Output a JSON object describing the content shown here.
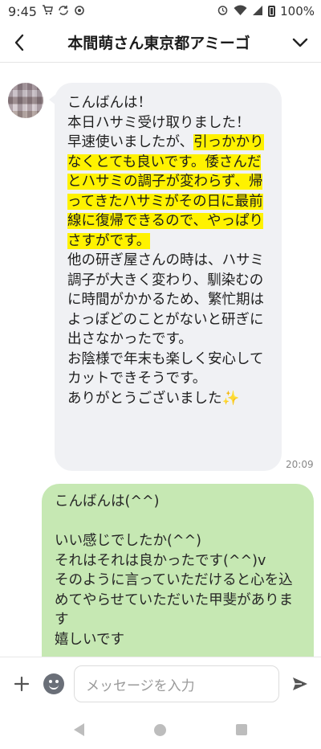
{
  "status_bar": {
    "time": "9:45",
    "battery_percent": "100%",
    "left_icons": [
      "cart-icon",
      "sync-icon",
      "settings-icon"
    ],
    "right_icons": [
      "alarm-icon",
      "wifi-icon",
      "signal-icon",
      "battery-icon"
    ]
  },
  "header": {
    "title": "本間萌さん東京都アミーゴ",
    "back_icon": "back-arrow-icon",
    "menu_icon": "chevron-down-icon"
  },
  "messages": [
    {
      "direction": "incoming",
      "segments": [
        {
          "text": "こんばんは！\n本日ハサミ受け取りました！\n早速使いましたが、",
          "highlight": false
        },
        {
          "text": "引っかかりなくとても良いです。倭さんだとハサミの調子が変わらず、帰ってきたハサミがその日に最前線に復帰できるので、やっぱりさすがです。",
          "highlight": true
        },
        {
          "text": "\n他の研ぎ屋さんの時は、ハサミ調子が大きく変わり、馴染むのに時間がかかるため、繁忙期はよっぽどのことがないと研ぎに出さなかったです。\nお陰様で年末も楽しく安心してカットできそうです。\nありがとうございました✨",
          "highlight": false
        }
      ],
      "time": "20:09"
    },
    {
      "direction": "outgoing",
      "text": "こんばんは(^^)\n\nいい感じでしたか(^^)\nそれはそれは良かったです(^^)v\nそのように言っていただけると心を込めてやらせていただいた甲斐があります\n嬉しいです"
    }
  ],
  "input": {
    "placeholder": "メッセージを入力",
    "plus_icon": "plus-icon",
    "emoji_icon": "emoji-icon",
    "send_icon": "send-icon"
  },
  "colors": {
    "incoming_bubble": "#f0f1f4",
    "outgoing_bubble": "#c6e8b3",
    "highlight": "#fff200"
  }
}
